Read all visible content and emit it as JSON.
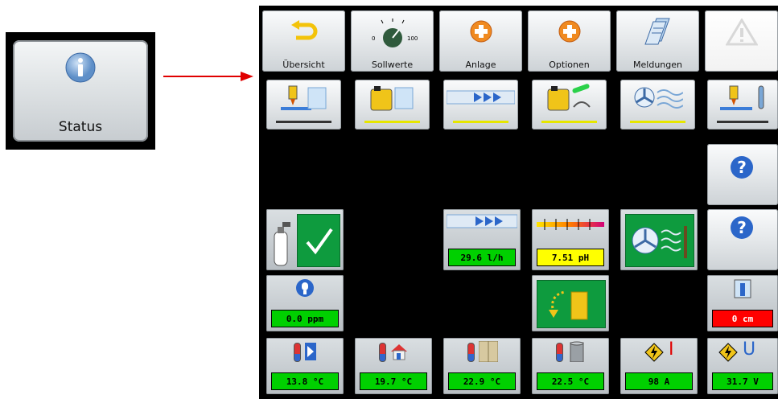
{
  "status_preview": {
    "label": "Status",
    "icon": "info-icon"
  },
  "toolbar": [
    {
      "id": "uebersicht",
      "label": "Übersicht",
      "icon": "back-arrow-icon"
    },
    {
      "id": "sollwerte",
      "label": "Sollwerte",
      "icon": "dial-icon",
      "dial_min": "0",
      "dial_max": "100"
    },
    {
      "id": "anlage",
      "label": "Anlage",
      "icon": "plus-circle-icon"
    },
    {
      "id": "optionen",
      "label": "Optionen",
      "icon": "plus-circle-icon"
    },
    {
      "id": "meldungen",
      "label": "Meldungen",
      "icon": "documents-icon"
    },
    {
      "id": "warning",
      "label": "",
      "icon": "warning-triangle-icon"
    }
  ],
  "readings": {
    "flow": "29.6 l/h",
    "ph": "7.51 pH",
    "ppm": "0.0 ppm",
    "level": "0 cm",
    "temp_outdoor": "13.8 °C",
    "temp_house": "19.7 °C",
    "temp_door": "22.9 °C",
    "temp_pipe": "22.5 °C",
    "current": "98 A",
    "voltage": "31.7 V"
  },
  "symbols": {
    "current": "I",
    "voltage": "U"
  },
  "colors": {
    "value_green": "#00d000",
    "value_yellow": "#ffff00",
    "value_red": "#ff0000",
    "tile_green": "#0e9b3e",
    "arrow": "#e00000"
  }
}
